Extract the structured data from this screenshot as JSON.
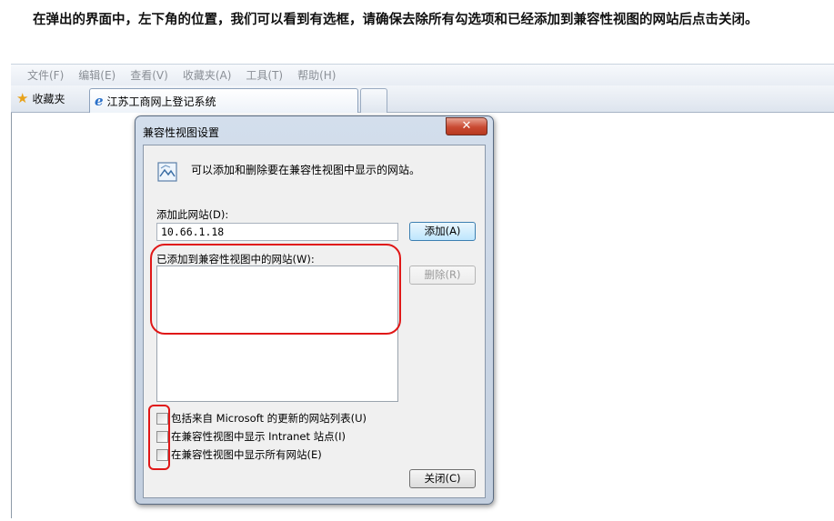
{
  "instruction": "在弹出的界面中，左下角的位置，我们可以看到有选框，请确保去除所有勾选项和已经添加到兼容性视图的网站后点击关闭。",
  "browser": {
    "menu": [
      "文件(F)",
      "编辑(E)",
      "查看(V)",
      "收藏夹(A)",
      "工具(T)",
      "帮助(H)"
    ],
    "favorites_label": "收藏夹",
    "tab_title": "江苏工商网上登记系统"
  },
  "dialog": {
    "title": "兼容性视图设置",
    "close_symbol": "✕",
    "description": "可以添加和删除要在兼容性视图中显示的网站。",
    "add_site_label": "添加此网站(D):",
    "add_site_value": "10.66.1.18",
    "add_button": "添加(A)",
    "added_sites_label": "已添加到兼容性视图中的网站(W):",
    "added_sites": [],
    "remove_button": "删除(R)",
    "checkboxes": [
      {
        "label": "包括来自 Microsoft 的更新的网站列表(U)",
        "checked": false
      },
      {
        "label": "在兼容性视图中显示 Intranet 站点(I)",
        "checked": false
      },
      {
        "label": "在兼容性视图中显示所有网站(E)",
        "checked": false
      }
    ],
    "close_button": "关闭(C)"
  },
  "colors": {
    "annotation": "#e01717",
    "close_button": "#c94a32",
    "primary_button": "#bee6fd"
  }
}
